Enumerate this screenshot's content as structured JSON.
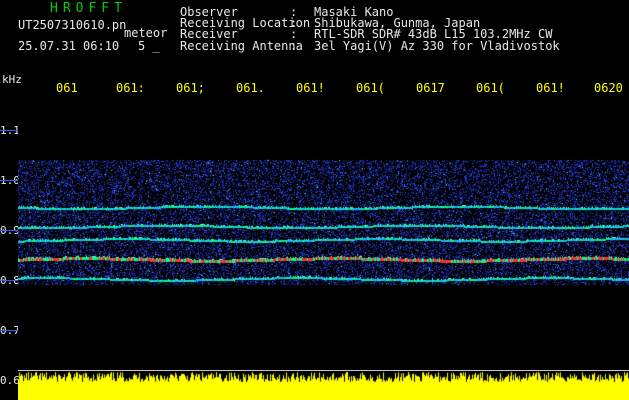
{
  "header": {
    "app_title": "HROFFT",
    "file_name": "UT2507310610.pn",
    "mode": "meteor",
    "datetime": "25.07.31 06:10",
    "number": "5 _",
    "fields": [
      {
        "label": "Observer",
        "value": "Masaki Kano"
      },
      {
        "label": "Receiving Location",
        "value": "Shibukawa, Gunma, Japan"
      },
      {
        "label": "Receiver",
        "value": "RTL-SDR SDR# 43dB L15 103.2MHz CW"
      },
      {
        "label": "Receiving Antenna",
        "value": "3el Yagi(V) Az 330 for Vladivostok"
      }
    ]
  },
  "y_axis": {
    "unit": "kHz",
    "labels": [
      "1.1",
      "1.0",
      "0.9",
      "0.8",
      "0.7",
      "0.6"
    ]
  },
  "time_axis": {
    "labels": [
      "061",
      "061:",
      "061;",
      "061.",
      "061!",
      "061(",
      "0617",
      "061(",
      "061!",
      "0620"
    ]
  },
  "colors": {
    "background": "#000000",
    "title": "#00d000",
    "text": "#e8e8e8",
    "time_labels": "#ffff00",
    "signal_strong": "#ff3030",
    "signal_mid": "#00ff90",
    "noise": "#2040ff",
    "level_bars": "#ffff00"
  },
  "spectrogram": {
    "band_top_khz": 1.02,
    "band_bottom_khz": 0.77,
    "lines_khz": [
      0.925,
      0.887,
      0.86,
      0.822,
      0.782
    ]
  }
}
